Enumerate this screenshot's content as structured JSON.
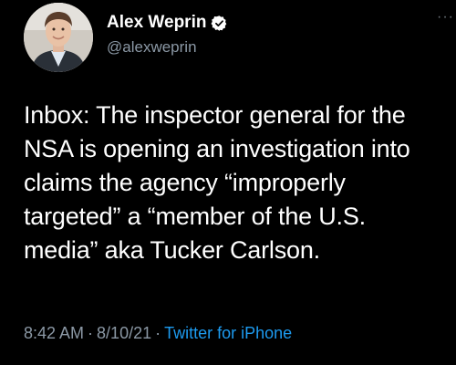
{
  "author": {
    "display_name": "Alex Weprin",
    "handle": "@alexweprin",
    "verified": true,
    "avatar_icon": "profile-photo"
  },
  "tweet": {
    "text": "Inbox: The inspector general for the\nNSA is opening an investigation into\nclaims the agency “improperly\ntargeted” a “member of the U.S.\nmedia” aka Tucker Carlson."
  },
  "meta": {
    "time": "8:42 AM",
    "separator": "·",
    "date": "8/10/21",
    "source": "Twitter for iPhone"
  },
  "colors": {
    "background": "#000000",
    "text_primary": "#ffffff",
    "text_secondary": "#8b98a5",
    "link": "#1d9bf0",
    "verified_badge": "#ffffff"
  }
}
